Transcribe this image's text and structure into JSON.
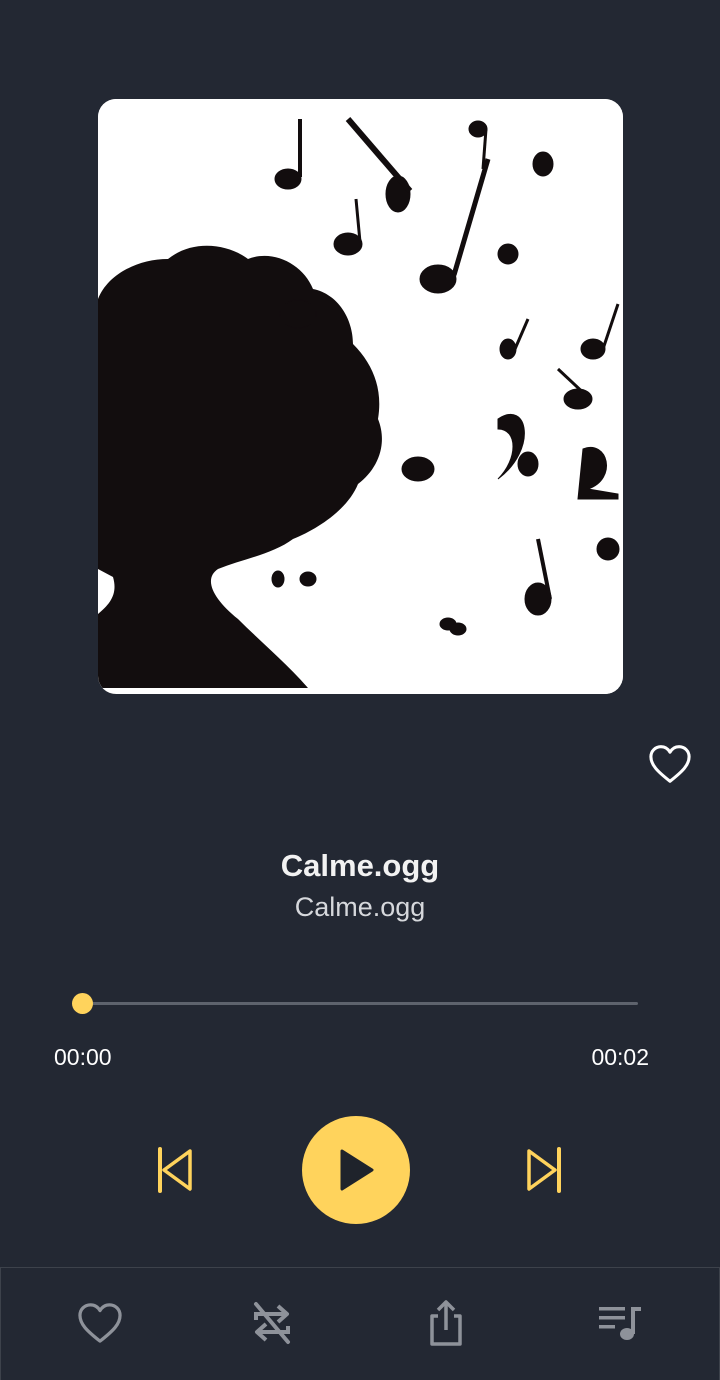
{
  "track": {
    "title": "Calme.ogg",
    "artist": "Calme.ogg",
    "album_art": "silhouette-head-with-music-notes"
  },
  "playback": {
    "current_time": "00:00",
    "duration": "00:02",
    "progress": 0.0,
    "state": "paused"
  },
  "controls": {
    "favorite_icon": "heart-outline-icon",
    "previous_icon": "skip-previous-icon",
    "play_icon": "play-icon",
    "next_icon": "skip-next-icon"
  },
  "bottom_bar": {
    "items": [
      "heart-icon",
      "repeat-off-icon",
      "share-icon",
      "playlist-icon"
    ]
  },
  "colors": {
    "background": "#232833",
    "accent": "#ffd35c",
    "seek_track": "#5e636d",
    "bottom_icons": "#8e929a"
  }
}
